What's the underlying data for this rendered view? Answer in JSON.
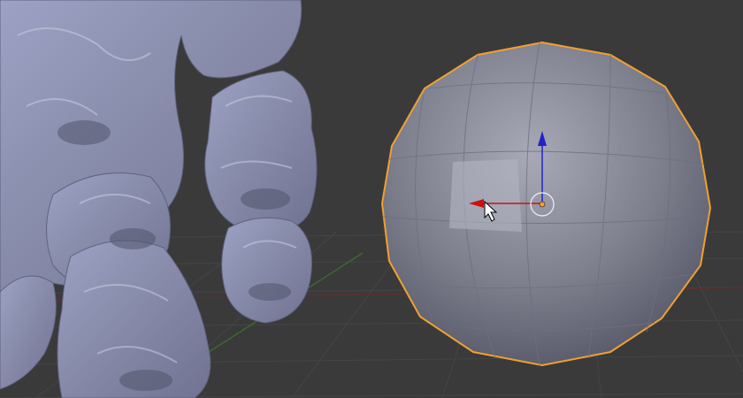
{
  "viewport": {
    "background": "#3a3a3a",
    "grid_color": "#454545",
    "x_axis_color": "#6b2a2a",
    "y_axis_color": "#3b6b2e"
  },
  "objects": {
    "sculpt_mesh": {
      "name": "",
      "color": "#8f93b5"
    },
    "sphere": {
      "name": "",
      "color": "#8a8c9c",
      "selected": true,
      "outline_color": "#f0a030"
    }
  },
  "gizmo": {
    "x_axis_color": "#cc1111",
    "z_axis_color": "#2222cc",
    "origin_color": "#f0a030"
  },
  "cursor": {
    "icon": "arrow-cursor-icon"
  }
}
